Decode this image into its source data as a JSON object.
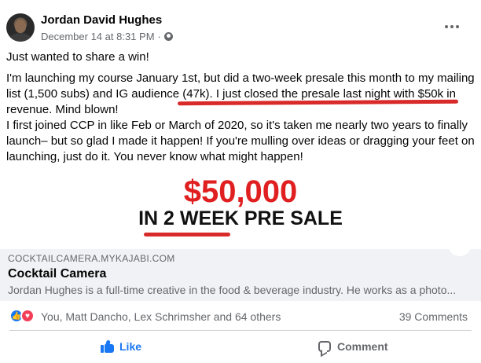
{
  "post": {
    "author": "Jordan David Hughes",
    "timestamp": "December 14 at 8:31 PM",
    "separator": "·",
    "privacy_icon": "globe-icon",
    "paragraphs": {
      "p1": "Just wanted to share a win!",
      "p2_before": "I'm launching my course January 1st, but did a two-week presale this month to my mailing list (1,500 subs) and IG audience (47k). ",
      "p2_highlight": "I just closed the presale last night with $50k in revenue.",
      "p2_after": " Mind blown!",
      "p3": "I first joined CCP in like Feb or March of 2020, so it's taken me nearly two years to finally launch– but so glad I made it happen! If you're mulling over ideas or dragging your feet on launching, just do it. You never know what might happen!"
    }
  },
  "overlay": {
    "amount": "$50,000",
    "tagline_pre": "IN ",
    "tagline_accent": "2 WEEK",
    "tagline_post": " PRE SALE",
    "accent_color": "#e02020"
  },
  "link_preview": {
    "domain": "COCKTAILCAMERA.MYKAJABI.COM",
    "title": "Cocktail Camera",
    "description": "Jordan Hughes is a full-time creative in the food & beverage industry. He works as a photo..."
  },
  "engagement": {
    "reaction_names": "You, Matt Dancho, Lex Schrimsher and 64 others",
    "comments": "39 Comments"
  },
  "actions": {
    "like_label": "Like",
    "comment_label": "Comment"
  },
  "colors": {
    "brand_blue": "#1877f2",
    "love_red": "#f33e58",
    "highlight_red": "#d92a2a"
  }
}
